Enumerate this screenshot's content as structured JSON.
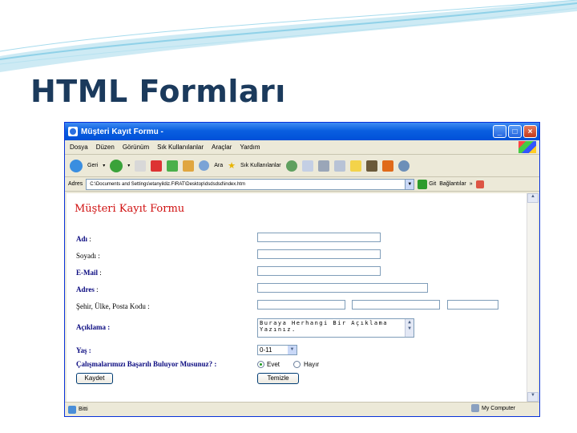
{
  "slide": {
    "title": "HTML Formları",
    "colors": {
      "title": "#1b3a5c",
      "swoosh": "#8fd1e8"
    }
  },
  "window": {
    "title": "Müşteri Kayıt Formu -",
    "controls": {
      "minimize": "_",
      "maximize": "□",
      "close": "×"
    }
  },
  "menu": {
    "items": [
      "Dosya",
      "Düzen",
      "Görünüm",
      "Sık Kullanılanlar",
      "Araçlar",
      "Yardım"
    ]
  },
  "toolbar": {
    "back_label": "Geri",
    "search_label": "Ara",
    "favorites_label": "Sık Kullanılanlar"
  },
  "address": {
    "label": "Adres",
    "value": "C:\\Documents and Settings\\etanyildiz.FIRAT\\Desktop\\dsdsdsd\\index.htm",
    "go_label": "Git",
    "links_label": "Bağlantılar"
  },
  "form": {
    "heading": "Müşteri Kayıt Formu",
    "fields": {
      "ad": "Adı",
      "soyad": "Soyadı :",
      "email": "E-Mail",
      "adres": "Adres",
      "sehir": "Şehir, Ülke, Posta Kodu :",
      "aciklama": "Açıklama :",
      "yas": "Yaş :",
      "basari": "Çalışmalarımızı Başarılı Buluyor Musunuz? :"
    },
    "textarea_value": "Buraya Herhangi Bir Açıklama Yazınız.",
    "age_selected": "0-11",
    "radio_options": [
      "Evet",
      "Hayır"
    ],
    "radio_selected": "Evet",
    "submit_label": "Kaydet",
    "reset_label": "Temizle"
  },
  "status": {
    "left": "Bitti",
    "zone": "My Computer"
  }
}
